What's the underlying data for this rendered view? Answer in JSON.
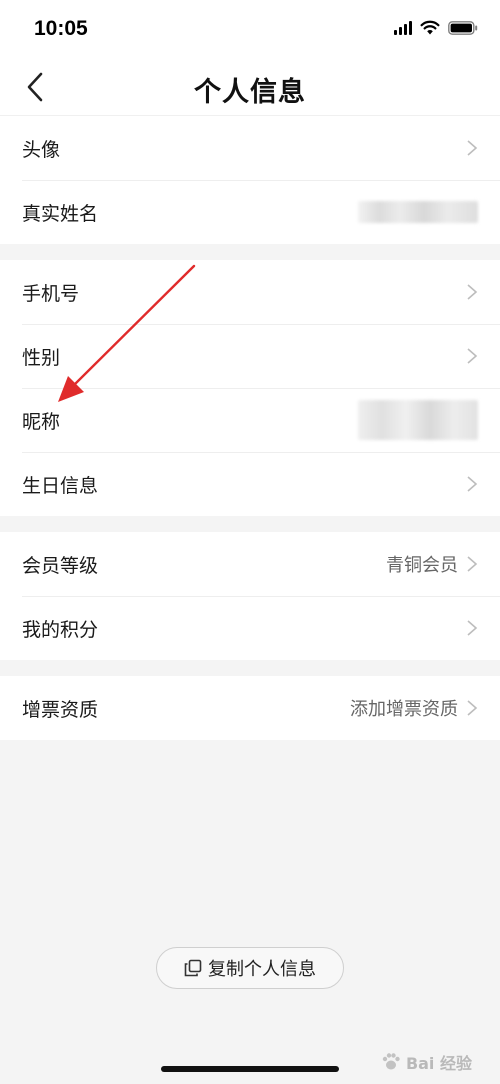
{
  "status_bar": {
    "time": "10:05"
  },
  "nav": {
    "title": "个人信息"
  },
  "groups": [
    {
      "rows": [
        {
          "label": "头像"
        },
        {
          "label": "真实姓名"
        }
      ]
    },
    {
      "rows": [
        {
          "label": "手机号"
        },
        {
          "label": "性别"
        },
        {
          "label": "昵称"
        },
        {
          "label": "生日信息"
        }
      ]
    },
    {
      "rows": [
        {
          "label": "会员等级",
          "value": "青铜会员"
        },
        {
          "label": "我的积分"
        }
      ]
    },
    {
      "rows": [
        {
          "label": "增票资质",
          "value": "添加增票资质"
        }
      ]
    }
  ],
  "copy_button": {
    "label": "复制个人信息"
  },
  "watermark": {
    "text": "Bai 经验"
  },
  "colors": {
    "annotation_arrow": "#e02b2b",
    "page_bg": "#f4f4f4"
  }
}
